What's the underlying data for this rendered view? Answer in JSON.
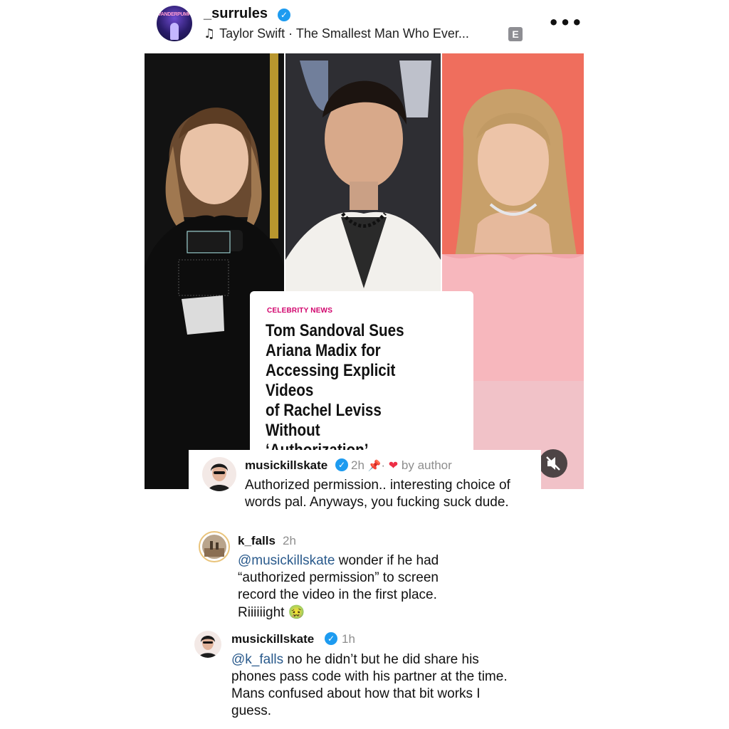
{
  "post": {
    "username": "_surrules",
    "verified_icon": "verified-badge-icon",
    "avatar_logo_text": "VANDERPUMP",
    "music_note_icon": "music-note-icon",
    "music": "Taylor Swift · The Smallest Man Who Ever...",
    "explicit_badge": "E",
    "more_label": "•••"
  },
  "article": {
    "category": "CELEBRITY NEWS",
    "headline": "Tom Sandoval Sues\nAriana Madix for\nAccessing Explicit Videos\nof Rachel Leviss Without\n‘Authorization’\n(Exclusive)"
  },
  "comments": [
    {
      "username": "musickillskate",
      "verified": true,
      "time": "2h",
      "pin_icon": "pin-icon",
      "separator": "·",
      "heart_icon": "heart-icon",
      "by_author": "by author",
      "text": "Authorized permission.. interesting choice of words pal. Anyways, you fucking suck dude."
    },
    {
      "username": "k_falls",
      "time": "2h",
      "mention": "@musickillskate",
      "text": " wonder if he had “authorized permission” to screen record the video in the first place. Riiiiiight",
      "emoji": "🤢"
    },
    {
      "username": "musickillskate",
      "verified": true,
      "time": "1h",
      "mention": "@k_falls",
      "text": " no he didn’t but he did share his phones pass code with his partner at the time. Mans confused about how that bit works I guess."
    }
  ],
  "colors": {
    "accent_verified": "#1d9bf0",
    "mention": "#2a5a8c",
    "category": "#d1006b",
    "heart": "#ed2f46"
  }
}
